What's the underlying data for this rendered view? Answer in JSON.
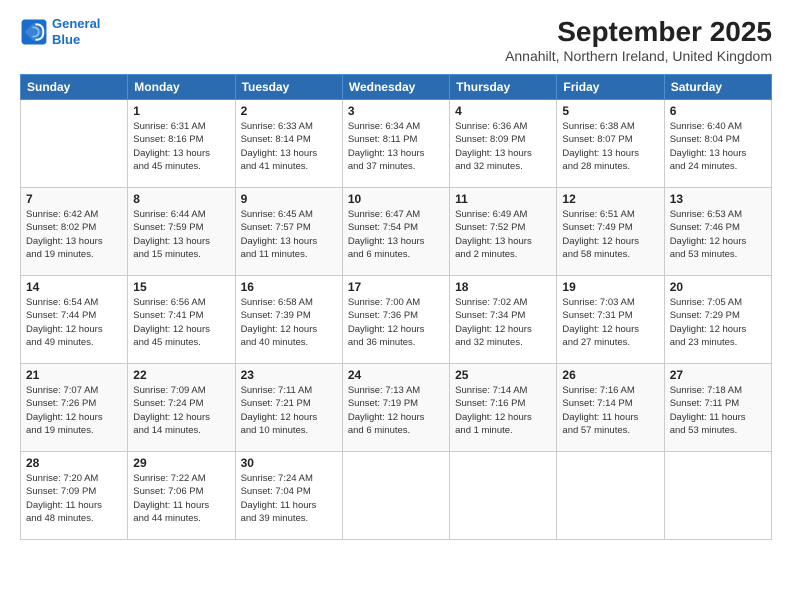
{
  "logo": {
    "line1": "General",
    "line2": "Blue"
  },
  "title": "September 2025",
  "subtitle": "Annahilt, Northern Ireland, United Kingdom",
  "weekdays": [
    "Sunday",
    "Monday",
    "Tuesday",
    "Wednesday",
    "Thursday",
    "Friday",
    "Saturday"
  ],
  "weeks": [
    [
      {
        "day": "",
        "info": ""
      },
      {
        "day": "1",
        "info": "Sunrise: 6:31 AM\nSunset: 8:16 PM\nDaylight: 13 hours\nand 45 minutes."
      },
      {
        "day": "2",
        "info": "Sunrise: 6:33 AM\nSunset: 8:14 PM\nDaylight: 13 hours\nand 41 minutes."
      },
      {
        "day": "3",
        "info": "Sunrise: 6:34 AM\nSunset: 8:11 PM\nDaylight: 13 hours\nand 37 minutes."
      },
      {
        "day": "4",
        "info": "Sunrise: 6:36 AM\nSunset: 8:09 PM\nDaylight: 13 hours\nand 32 minutes."
      },
      {
        "day": "5",
        "info": "Sunrise: 6:38 AM\nSunset: 8:07 PM\nDaylight: 13 hours\nand 28 minutes."
      },
      {
        "day": "6",
        "info": "Sunrise: 6:40 AM\nSunset: 8:04 PM\nDaylight: 13 hours\nand 24 minutes."
      }
    ],
    [
      {
        "day": "7",
        "info": "Sunrise: 6:42 AM\nSunset: 8:02 PM\nDaylight: 13 hours\nand 19 minutes."
      },
      {
        "day": "8",
        "info": "Sunrise: 6:44 AM\nSunset: 7:59 PM\nDaylight: 13 hours\nand 15 minutes."
      },
      {
        "day": "9",
        "info": "Sunrise: 6:45 AM\nSunset: 7:57 PM\nDaylight: 13 hours\nand 11 minutes."
      },
      {
        "day": "10",
        "info": "Sunrise: 6:47 AM\nSunset: 7:54 PM\nDaylight: 13 hours\nand 6 minutes."
      },
      {
        "day": "11",
        "info": "Sunrise: 6:49 AM\nSunset: 7:52 PM\nDaylight: 13 hours\nand 2 minutes."
      },
      {
        "day": "12",
        "info": "Sunrise: 6:51 AM\nSunset: 7:49 PM\nDaylight: 12 hours\nand 58 minutes."
      },
      {
        "day": "13",
        "info": "Sunrise: 6:53 AM\nSunset: 7:46 PM\nDaylight: 12 hours\nand 53 minutes."
      }
    ],
    [
      {
        "day": "14",
        "info": "Sunrise: 6:54 AM\nSunset: 7:44 PM\nDaylight: 12 hours\nand 49 minutes."
      },
      {
        "day": "15",
        "info": "Sunrise: 6:56 AM\nSunset: 7:41 PM\nDaylight: 12 hours\nand 45 minutes."
      },
      {
        "day": "16",
        "info": "Sunrise: 6:58 AM\nSunset: 7:39 PM\nDaylight: 12 hours\nand 40 minutes."
      },
      {
        "day": "17",
        "info": "Sunrise: 7:00 AM\nSunset: 7:36 PM\nDaylight: 12 hours\nand 36 minutes."
      },
      {
        "day": "18",
        "info": "Sunrise: 7:02 AM\nSunset: 7:34 PM\nDaylight: 12 hours\nand 32 minutes."
      },
      {
        "day": "19",
        "info": "Sunrise: 7:03 AM\nSunset: 7:31 PM\nDaylight: 12 hours\nand 27 minutes."
      },
      {
        "day": "20",
        "info": "Sunrise: 7:05 AM\nSunset: 7:29 PM\nDaylight: 12 hours\nand 23 minutes."
      }
    ],
    [
      {
        "day": "21",
        "info": "Sunrise: 7:07 AM\nSunset: 7:26 PM\nDaylight: 12 hours\nand 19 minutes."
      },
      {
        "day": "22",
        "info": "Sunrise: 7:09 AM\nSunset: 7:24 PM\nDaylight: 12 hours\nand 14 minutes."
      },
      {
        "day": "23",
        "info": "Sunrise: 7:11 AM\nSunset: 7:21 PM\nDaylight: 12 hours\nand 10 minutes."
      },
      {
        "day": "24",
        "info": "Sunrise: 7:13 AM\nSunset: 7:19 PM\nDaylight: 12 hours\nand 6 minutes."
      },
      {
        "day": "25",
        "info": "Sunrise: 7:14 AM\nSunset: 7:16 PM\nDaylight: 12 hours\nand 1 minute."
      },
      {
        "day": "26",
        "info": "Sunrise: 7:16 AM\nSunset: 7:14 PM\nDaylight: 11 hours\nand 57 minutes."
      },
      {
        "day": "27",
        "info": "Sunrise: 7:18 AM\nSunset: 7:11 PM\nDaylight: 11 hours\nand 53 minutes."
      }
    ],
    [
      {
        "day": "28",
        "info": "Sunrise: 7:20 AM\nSunset: 7:09 PM\nDaylight: 11 hours\nand 48 minutes."
      },
      {
        "day": "29",
        "info": "Sunrise: 7:22 AM\nSunset: 7:06 PM\nDaylight: 11 hours\nand 44 minutes."
      },
      {
        "day": "30",
        "info": "Sunrise: 7:24 AM\nSunset: 7:04 PM\nDaylight: 11 hours\nand 39 minutes."
      },
      {
        "day": "",
        "info": ""
      },
      {
        "day": "",
        "info": ""
      },
      {
        "day": "",
        "info": ""
      },
      {
        "day": "",
        "info": ""
      }
    ]
  ]
}
